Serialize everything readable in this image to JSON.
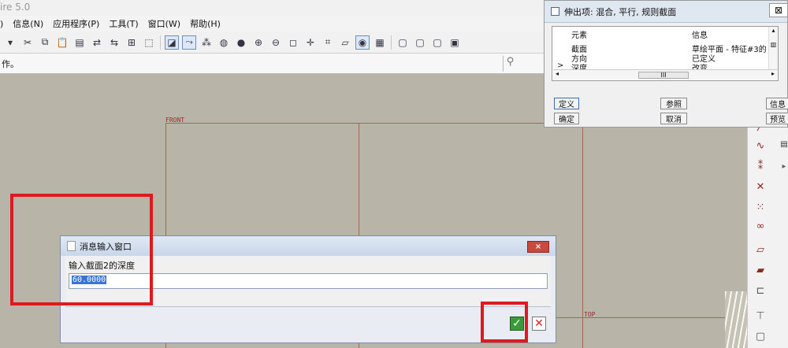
{
  "app": {
    "title_fragment": "ire 5.0"
  },
  "menu": [
    "信息(N)",
    "应用程序(P)",
    "工具(T)",
    "窗口(W)",
    "帮助(H)"
  ],
  "menu_prefix": ")",
  "status": {
    "text": "作。"
  },
  "planes": {
    "front": "FRONT",
    "top": "TOP"
  },
  "feature_dialog": {
    "title": "伸出项: 混合, 平行, 规则截面",
    "col_element": "元素",
    "col_info": "信息",
    "rows": [
      {
        "element": "截面",
        "info": "草绘平面 - 特征#3的"
      },
      {
        "element": "方向",
        "info": "已定义"
      },
      {
        "element": "深度",
        "info": "改变"
      }
    ],
    "arrow": ">",
    "scroll_thumb": "III",
    "buttons": {
      "define": "定义",
      "reference": "参照",
      "info": "信息",
      "ok": "确定",
      "cancel": "取消",
      "preview": "预览"
    }
  },
  "message_dialog": {
    "title": "消息输入窗口",
    "prompt": "输入截面2的深度",
    "value": "60.0000",
    "close_glyph": "×",
    "ok_glyph": "✓",
    "cancel_glyph": "✕"
  },
  "colors": {
    "highlight": "#e0191f",
    "datum": "#a06a50"
  }
}
